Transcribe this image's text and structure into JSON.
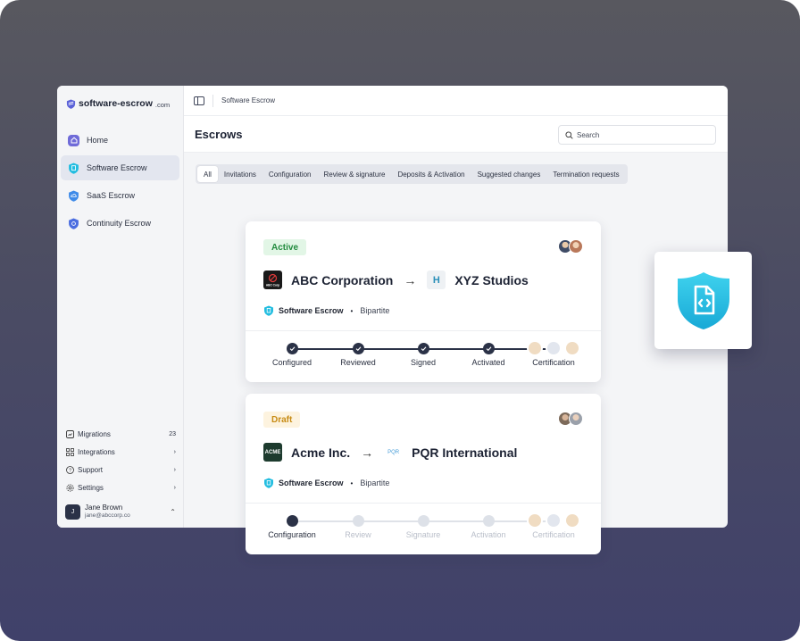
{
  "brand": {
    "name": "software-escrow",
    "domain": ".com",
    "icon": "escrow-shield-logo-icon"
  },
  "sidebar": {
    "items": [
      {
        "label": "Home",
        "icon": "home-icon",
        "active": false
      },
      {
        "label": "Software Escrow",
        "icon": "software-escrow-icon",
        "active": true
      },
      {
        "label": "SaaS Escrow",
        "icon": "cloud-shield-icon",
        "active": false
      },
      {
        "label": "Continuity Escrow",
        "icon": "continuity-shield-icon",
        "active": false
      }
    ],
    "bottom": [
      {
        "label": "Migrations",
        "icon": "migrations-icon",
        "trailing": "23"
      },
      {
        "label": "Integrations",
        "icon": "grid-icon",
        "trailing": "›"
      },
      {
        "label": "Support",
        "icon": "help-icon",
        "trailing": "›"
      },
      {
        "label": "Settings",
        "icon": "gear-icon",
        "trailing": "›"
      }
    ],
    "user": {
      "initial": "J",
      "name": "Jane Brown",
      "email": "jane@abccorp.co"
    }
  },
  "topbar": {
    "breadcrumb": "Software Escrow"
  },
  "header": {
    "title": "Escrows",
    "search_placeholder": "Search"
  },
  "tabs": [
    "All",
    "Invitations",
    "Configuration",
    "Review & signature",
    "Deposits & Activation",
    "Suggested changes",
    "Termination requests"
  ],
  "escrows": [
    {
      "status": "Active",
      "from": {
        "name": "ABC Corporation",
        "logo_text": "ABC Corp"
      },
      "to": {
        "name": "XYZ Studios",
        "logo_text": "H"
      },
      "type": "Software Escrow",
      "kind": "Bipartite",
      "steps": [
        "Configured",
        "Reviewed",
        "Signed",
        "Activated",
        "Certification"
      ],
      "progress_steps_completed": 4
    },
    {
      "status": "Draft",
      "from": {
        "name": "Acme Inc.",
        "logo_text": "ACME"
      },
      "to": {
        "name": "PQR International",
        "logo_text": "PQR"
      },
      "type": "Software Escrow",
      "kind": "Bipartite",
      "steps": [
        "Configuration",
        "Review",
        "Signature",
        "Activation",
        "Certification"
      ],
      "progress_steps_completed": 0
    }
  ],
  "colors": {
    "accent": "#2b3247",
    "escrow_cyan": "#22bde0",
    "active_green": "#228b3e",
    "draft_amber": "#c78b14"
  }
}
